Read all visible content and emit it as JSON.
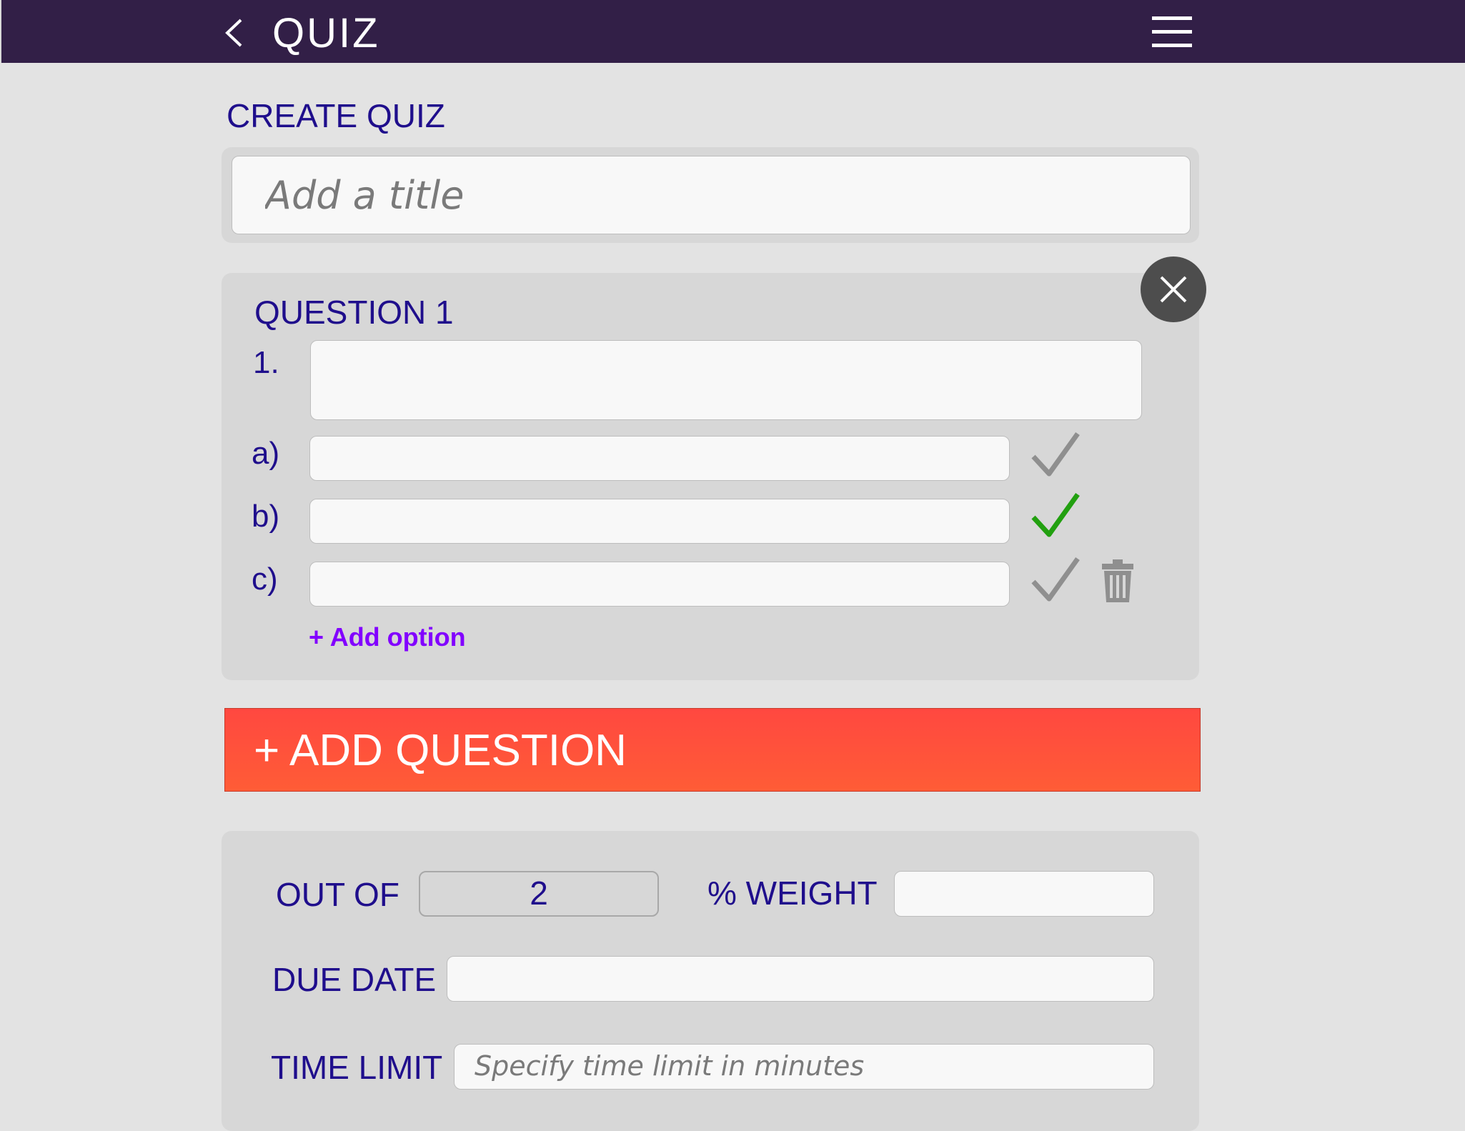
{
  "header": {
    "title": "QUIZ"
  },
  "create": {
    "section_title": "CREATE QUIZ",
    "title_placeholder": "Add a title"
  },
  "question": {
    "label": "QUESTION 1",
    "number": "1.",
    "options": [
      {
        "label": "a)",
        "correct": false
      },
      {
        "label": "b)",
        "correct": true
      },
      {
        "label": "c)",
        "correct": false
      }
    ],
    "add_option_label": "+ Add option"
  },
  "add_question_label": "+ ADD QUESTION",
  "settings": {
    "out_of_label": "OUT OF",
    "out_of_value": "2",
    "weight_label": "% WEIGHT",
    "due_date_label": "DUE DATE",
    "time_limit_label": "TIME LIMIT",
    "time_limit_placeholder": "Specify time limit in minutes"
  },
  "colors": {
    "header_bg": "#321f47",
    "label_text": "#1f0e8c",
    "add_option": "#8200ff",
    "add_question_bg": "#ff4c3c",
    "correct_check": "#22a010",
    "inactive_check": "#8f8f8f"
  }
}
